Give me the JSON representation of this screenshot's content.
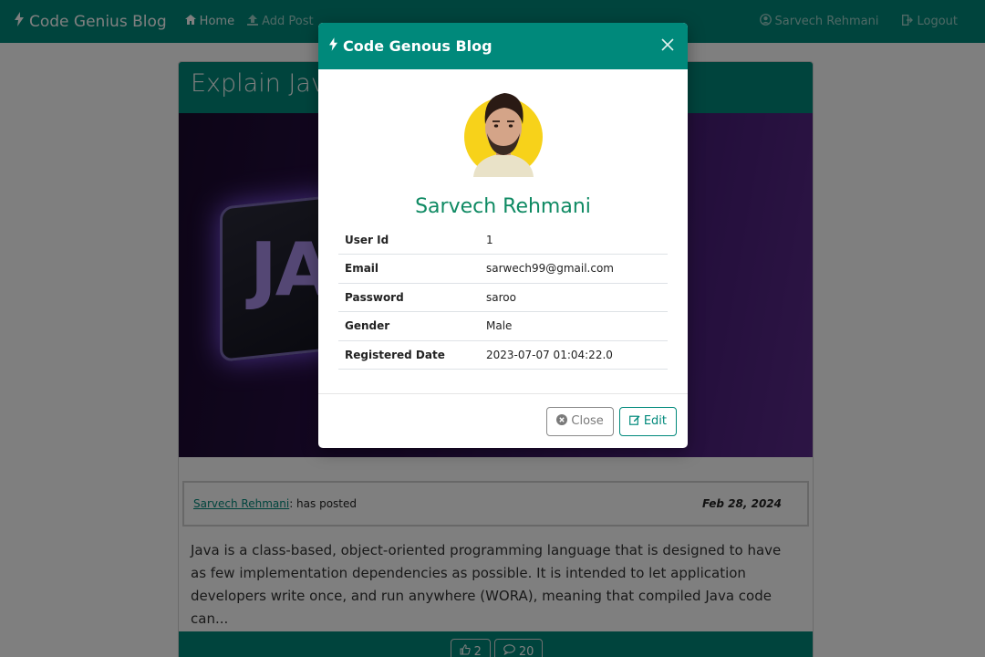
{
  "navbar": {
    "brand": "Code Genius Blog",
    "home": "Home",
    "add_post": "Add Post",
    "user": "Sarvech Rehmani",
    "logout": "Logout"
  },
  "post": {
    "title": "Explain Java",
    "image_text": "JA",
    "author": "Sarvech Rehmani",
    "posted_suffix": ": has posted",
    "date": "Feb 28, 2024",
    "body": "Java is a class-based, object-oriented programming language that is designed to have as few implementation dependencies as possible. It is intended to let application developers write once, and run anywhere (WORA), meaning that compiled Java code can...",
    "likes": "2",
    "comments": "20"
  },
  "modal": {
    "title": "Code Genous Blog",
    "user_name": "Sarvech Rehmani",
    "rows": [
      {
        "key": "User Id",
        "value": "1"
      },
      {
        "key": "Email",
        "value": "sarwech99@gmail.com"
      },
      {
        "key": "Password",
        "value": "saroo"
      },
      {
        "key": "Gender",
        "value": "Male"
      },
      {
        "key": "Registered Date",
        "value": "2023-07-07 01:04:22.0"
      }
    ],
    "close_label": "Close",
    "edit_label": "Edit"
  },
  "colors": {
    "primary": "#00897b",
    "name_green": "#0f8a63",
    "overlay": "rgba(0,0,0,0.5)"
  },
  "icons": [
    "bolt-icon",
    "home-icon",
    "upload-icon",
    "user-circle-icon",
    "sign-out-icon",
    "times-icon",
    "times-circle-icon",
    "edit-icon",
    "thumbs-up-icon",
    "comment-icon"
  ]
}
